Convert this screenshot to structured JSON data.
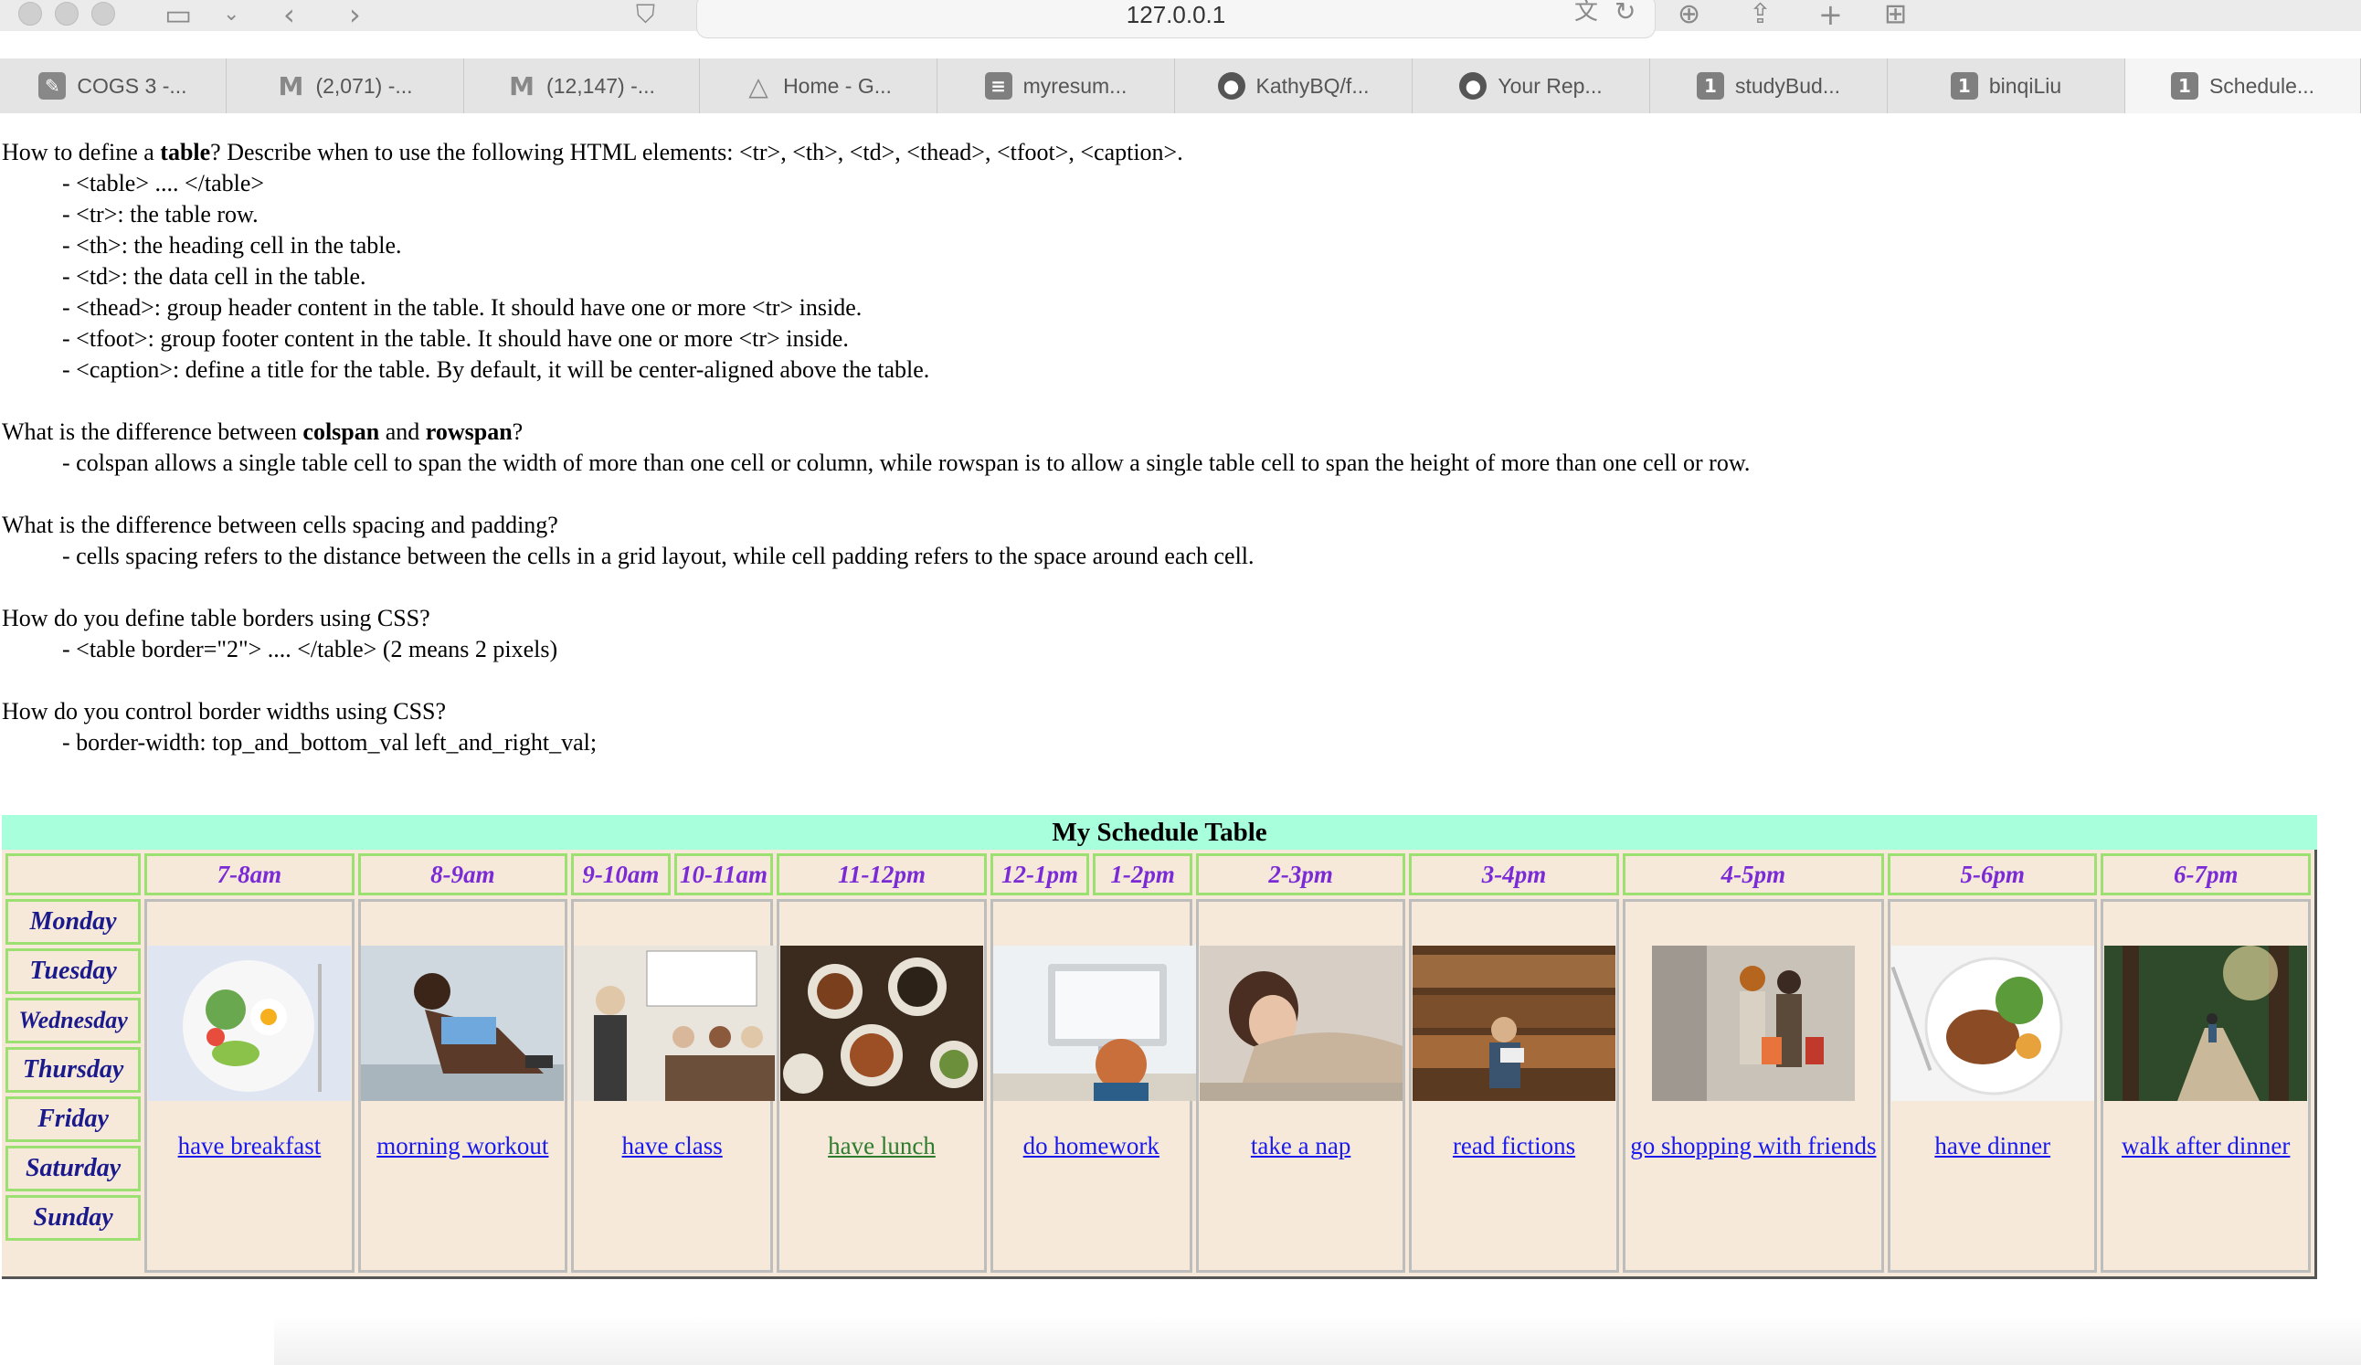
{
  "browser": {
    "url": "127.0.0.1",
    "tabs": [
      {
        "title": "COGS 3 -...",
        "icon": "document-icon"
      },
      {
        "title": "(2,071) -...",
        "icon": "gmail-icon"
      },
      {
        "title": "(12,147) -...",
        "icon": "gmail-icon"
      },
      {
        "title": "Home - G...",
        "icon": "drive-icon"
      },
      {
        "title": "myresum...",
        "icon": "document-icon"
      },
      {
        "title": "KathyBQ/f...",
        "icon": "github-icon"
      },
      {
        "title": "Your Rep...",
        "icon": "github-icon"
      },
      {
        "title": "studyBud...",
        "icon": "localhost-icon",
        "badge": "1"
      },
      {
        "title": "binqiLiu",
        "icon": "localhost-icon",
        "badge": "1"
      },
      {
        "title": "Schedule...",
        "icon": "localhost-icon",
        "badge": "1"
      }
    ]
  },
  "qa": {
    "q1_pre": "How to define a ",
    "q1_bold": "table",
    "q1_post": "? Describe when to use the following HTML elements: <tr>, <th>, <td>, <thead>, <tfoot>, <caption>.",
    "q1_answers": [
      "- <table> .... </table>",
      "- <tr>: the table row.",
      "- <th>: the heading cell in the table.",
      "- <td>: the data cell in the table.",
      "- <thead>: group header content in the table. It should have one or more <tr> inside.",
      "- <tfoot>: group footer content in the table. It should have one or more <tr> inside.",
      "- <caption>: define a title for the table. By default, it will be center-aligned above the table."
    ],
    "q2_pre": "What is the difference between ",
    "q2_bold1": "colspan",
    "q2_mid": " and ",
    "q2_bold2": "rowspan",
    "q2_post": "?",
    "q2_answer": "- colspan allows a single table cell to span the width of more than one cell or column, while rowspan is to allow a single table cell to span the height of more than one cell or row.",
    "q3": "What is the difference between cells spacing and padding?",
    "q3_answer": "- cells spacing refers to the distance between the cells in a grid layout, while cell padding refers to the space around each cell.",
    "q4": "How do you define table borders using CSS?",
    "q4_answer": "- <table border=\"2\"> .... </table> (2 means 2 pixels)",
    "q5": "How do you control border widths using CSS?",
    "q5_answer": "- border-width: top_and_bottom_val left_and_right_val;"
  },
  "schedule": {
    "caption": "My Schedule Table",
    "times": [
      "7-8am",
      "8-9am",
      "9-10am",
      "10-11am",
      "11-12pm",
      "12-1pm",
      "1-2pm",
      "2-3pm",
      "3-4pm",
      "4-5pm",
      "5-6pm",
      "6-7pm"
    ],
    "days": [
      "Monday",
      "Tuesday",
      "Wednesday",
      "Thursday",
      "Friday",
      "Saturday",
      "Sunday"
    ],
    "activities": [
      {
        "label": "have breakfast",
        "image": "breakfast-plate-image"
      },
      {
        "label": "morning workout",
        "image": "workout-image"
      },
      {
        "label": "have class",
        "image": "classroom-image"
      },
      {
        "label": "have lunch",
        "image": "lunch-table-image",
        "visited": true
      },
      {
        "label": "do homework",
        "image": "computer-desk-image"
      },
      {
        "label": "take a nap",
        "image": "nap-image"
      },
      {
        "label": "read fictions",
        "image": "library-reading-image"
      },
      {
        "label": "go shopping with friends",
        "image": "shopping-friends-image"
      },
      {
        "label": "have dinner",
        "image": "dinner-plate-image"
      },
      {
        "label": "walk after dinner",
        "image": "forest-walk-image"
      }
    ]
  }
}
